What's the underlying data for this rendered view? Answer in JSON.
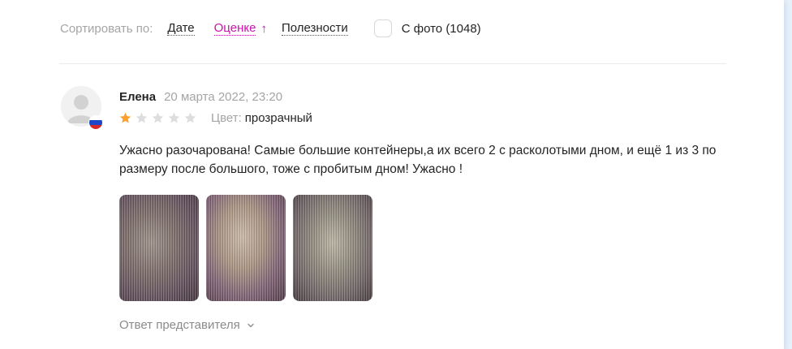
{
  "sort": {
    "label": "Сортировать по:",
    "options": [
      {
        "label": "Дате",
        "active": false
      },
      {
        "label": "Оценке",
        "active": true
      },
      {
        "label": "Полезности",
        "active": false
      }
    ],
    "active_arrow": "↑",
    "photo_filter_label": "С фото (1048)",
    "photo_filter_checked": false
  },
  "review": {
    "author": "Елена",
    "date": "20 марта 2022, 23:20",
    "rating": 1,
    "rating_max": 5,
    "color_label": "Цвет:",
    "color_value": "прозрачный",
    "text": "Ужасно разочарована! Самые большие контейнеры,а их всего 2 с расколотыми дном, и ещё 1 из 3 по размеру после большого, тоже с пробитым дном! Ужасно !",
    "photos_count": 3,
    "answer_label": "Ответ представителя"
  },
  "colors": {
    "accent": "#cb11ab",
    "star_filled": "#ff9f2d",
    "star_empty": "#dddddd"
  },
  "icons": {
    "avatar": "user-avatar-icon",
    "flag": "russia-flag-icon",
    "star": "star-icon",
    "sort_arrow": "arrow-up-icon",
    "answer_toggle": "chevron-down-icon"
  }
}
